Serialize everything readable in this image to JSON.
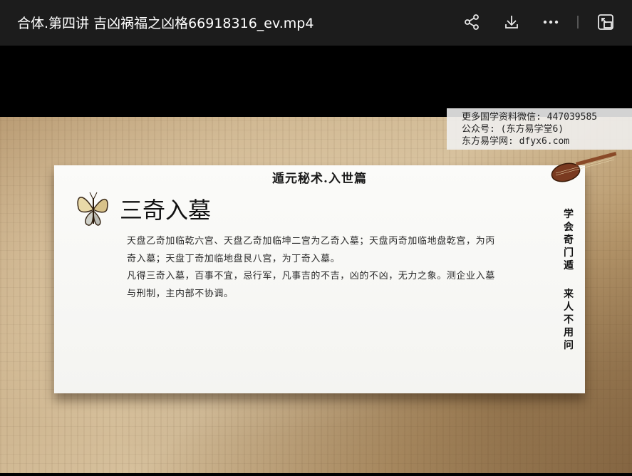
{
  "window": {
    "title": "合体.第四讲 吉凶祸福之凶格66918316_ev.mp4"
  },
  "toolbar": {
    "icons": [
      "share-icon",
      "download-icon",
      "more-icon",
      "exit-window-icon"
    ]
  },
  "watermark": {
    "line1": "更多国学资料微信: 447039585",
    "line2": "公众号: (东方易学堂6)",
    "line3": "东方易学网: dfyx6.com"
  },
  "slide": {
    "header": "遁元秘术.入世篇",
    "title": "三奇入墓",
    "paragraph1": "天盘乙奇加临乾六宫、天盘乙奇加临坤二宫为乙奇入墓；天盘丙奇加临地盘乾宫，为丙奇入墓；天盘丁奇加临地盘艮八宫，为丁奇入墓。",
    "paragraph2": "凡得三奇入墓，百事不宜，忌行军，凡事吉的不吉，凶的不凶，无力之象。测企业入墓与刑制，主内部不协调。",
    "slogan_top": [
      "学",
      "会",
      "奇",
      "门",
      "遁"
    ],
    "slogan_bottom": [
      "来",
      "人",
      "不",
      "用",
      "问"
    ]
  },
  "colors": {
    "topbar": "#1c1c1c",
    "video_bg": "#000000",
    "card": "#f8f8f6",
    "parchment": "#cdb48e"
  }
}
